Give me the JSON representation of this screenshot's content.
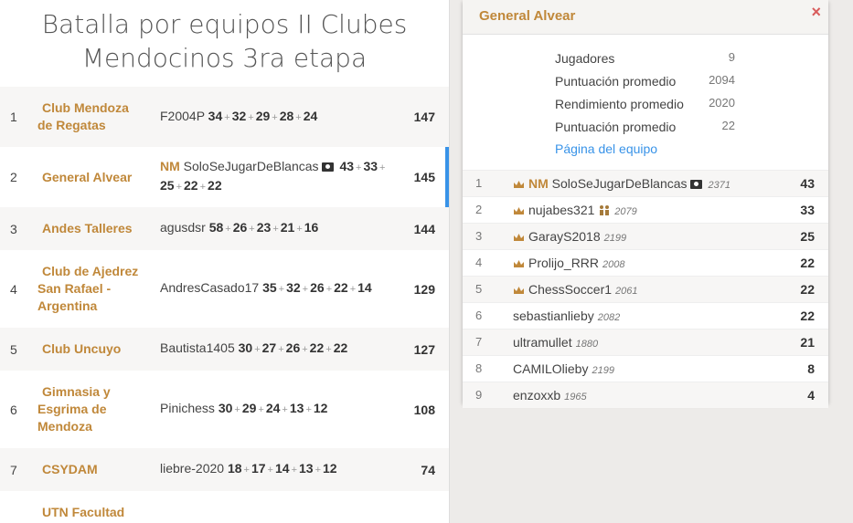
{
  "title": {
    "line1": "Batalla por equipos II Clubes",
    "line2": "Mendocinos 3ra etapa"
  },
  "teams": [
    {
      "rank": "1",
      "name_l1": "Club Mendoza",
      "name_l2": "de Regatas",
      "name_l3": "",
      "leader": "F2004P",
      "leader_title": "",
      "scores": [
        "34",
        "32",
        "29",
        "28",
        "24"
      ],
      "total": "147"
    },
    {
      "rank": "2",
      "name_l1": "General Alvear",
      "name_l2": "",
      "name_l3": "",
      "leader": "SoloSeJugarDeBlancas",
      "leader_title": "NM",
      "scores": [
        "43",
        "33",
        "25",
        "22",
        "22"
      ],
      "total": "145"
    },
    {
      "rank": "3",
      "name_l1": "Andes Talleres",
      "name_l2": "",
      "name_l3": "",
      "leader": "agusdsr",
      "leader_title": "",
      "scores": [
        "58",
        "26",
        "23",
        "21",
        "16"
      ],
      "total": "144"
    },
    {
      "rank": "4",
      "name_l1": "Club de Ajedrez",
      "name_l2": "San Rafael -",
      "name_l3": "Argentina",
      "leader": "AndresCasado17",
      "leader_title": "",
      "scores": [
        "35",
        "32",
        "26",
        "22",
        "14"
      ],
      "total": "129"
    },
    {
      "rank": "5",
      "name_l1": "Club Uncuyo",
      "name_l2": "",
      "name_l3": "",
      "leader": "Bautista1405",
      "leader_title": "",
      "scores": [
        "30",
        "27",
        "26",
        "22",
        "22"
      ],
      "total": "127"
    },
    {
      "rank": "6",
      "name_l1": "Gimnasia y",
      "name_l2": "Esgrima de",
      "name_l3": "Mendoza",
      "leader": "Pinichess",
      "leader_title": "",
      "scores": [
        "30",
        "29",
        "24",
        "13",
        "12"
      ],
      "total": "108"
    },
    {
      "rank": "7",
      "name_l1": "CSYDAM",
      "name_l2": "",
      "name_l3": "",
      "leader": "liebre-2020",
      "leader_title": "",
      "scores": [
        "18",
        "17",
        "14",
        "13",
        "12"
      ],
      "total": "74"
    },
    {
      "rank": "",
      "name_l1": "UTN Facultad",
      "name_l2": "",
      "name_l3": "",
      "leader": "",
      "leader_title": "",
      "scores": [],
      "total": ""
    }
  ],
  "panel": {
    "team_name": "General Alvear",
    "close_glyph": "×",
    "stats": [
      {
        "label": "Jugadores",
        "value": "9"
      },
      {
        "label": "Puntuación promedio",
        "value": "2094"
      },
      {
        "label": "Rendimiento promedio",
        "value": "2020"
      },
      {
        "label": "Puntuación promedio",
        "value": "22"
      }
    ],
    "team_page_link": "Página del equipo",
    "players": [
      {
        "rank": "1",
        "title": "NM",
        "name": "SoloSeJugarDeBlancas",
        "rating": "2371",
        "score": "43",
        "leader": true,
        "badge": "flag"
      },
      {
        "rank": "2",
        "title": "",
        "name": "nujabes321",
        "rating": "2079",
        "score": "33",
        "leader": true,
        "badge": "people"
      },
      {
        "rank": "3",
        "title": "",
        "name": "GarayS2018",
        "rating": "2199",
        "score": "25",
        "leader": true,
        "badge": ""
      },
      {
        "rank": "4",
        "title": "",
        "name": "Prolijo_RRR",
        "rating": "2008",
        "score": "22",
        "leader": true,
        "badge": ""
      },
      {
        "rank": "5",
        "title": "",
        "name": "ChessSoccer1",
        "rating": "2061",
        "score": "22",
        "leader": true,
        "badge": ""
      },
      {
        "rank": "6",
        "title": "",
        "name": "sebastianlieby",
        "rating": "2082",
        "score": "22",
        "leader": false,
        "badge": ""
      },
      {
        "rank": "7",
        "title": "",
        "name": "ultramullet",
        "rating": "1880",
        "score": "21",
        "leader": false,
        "badge": ""
      },
      {
        "rank": "8",
        "title": "",
        "name": "CAMILOlieby",
        "rating": "2199",
        "score": "8",
        "leader": false,
        "badge": ""
      },
      {
        "rank": "9",
        "title": "",
        "name": "enzoxxb",
        "rating": "1965",
        "score": "4",
        "leader": false,
        "badge": ""
      }
    ]
  },
  "colors": {
    "accent": "#c0883a",
    "link": "#3893e8",
    "close": "#d85c5c"
  }
}
